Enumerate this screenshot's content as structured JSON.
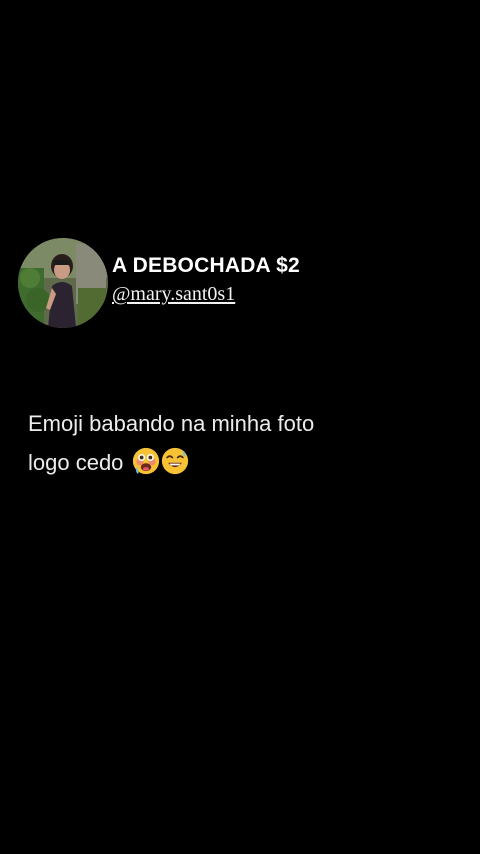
{
  "profile": {
    "display_name": "A DEBOCHADA $2",
    "handle": "@mary.sant0s1",
    "avatar": "profile-photo-avatar"
  },
  "post": {
    "line1": "Emoji babando na minha foto",
    "line2": "logo cedo",
    "emojis": [
      "drooling-flushed-face-emoji",
      "sweat-smile-face-emoji"
    ]
  },
  "colors": {
    "background": "#000000",
    "text": "#ffffff",
    "emoji_face": "#f7c233"
  }
}
